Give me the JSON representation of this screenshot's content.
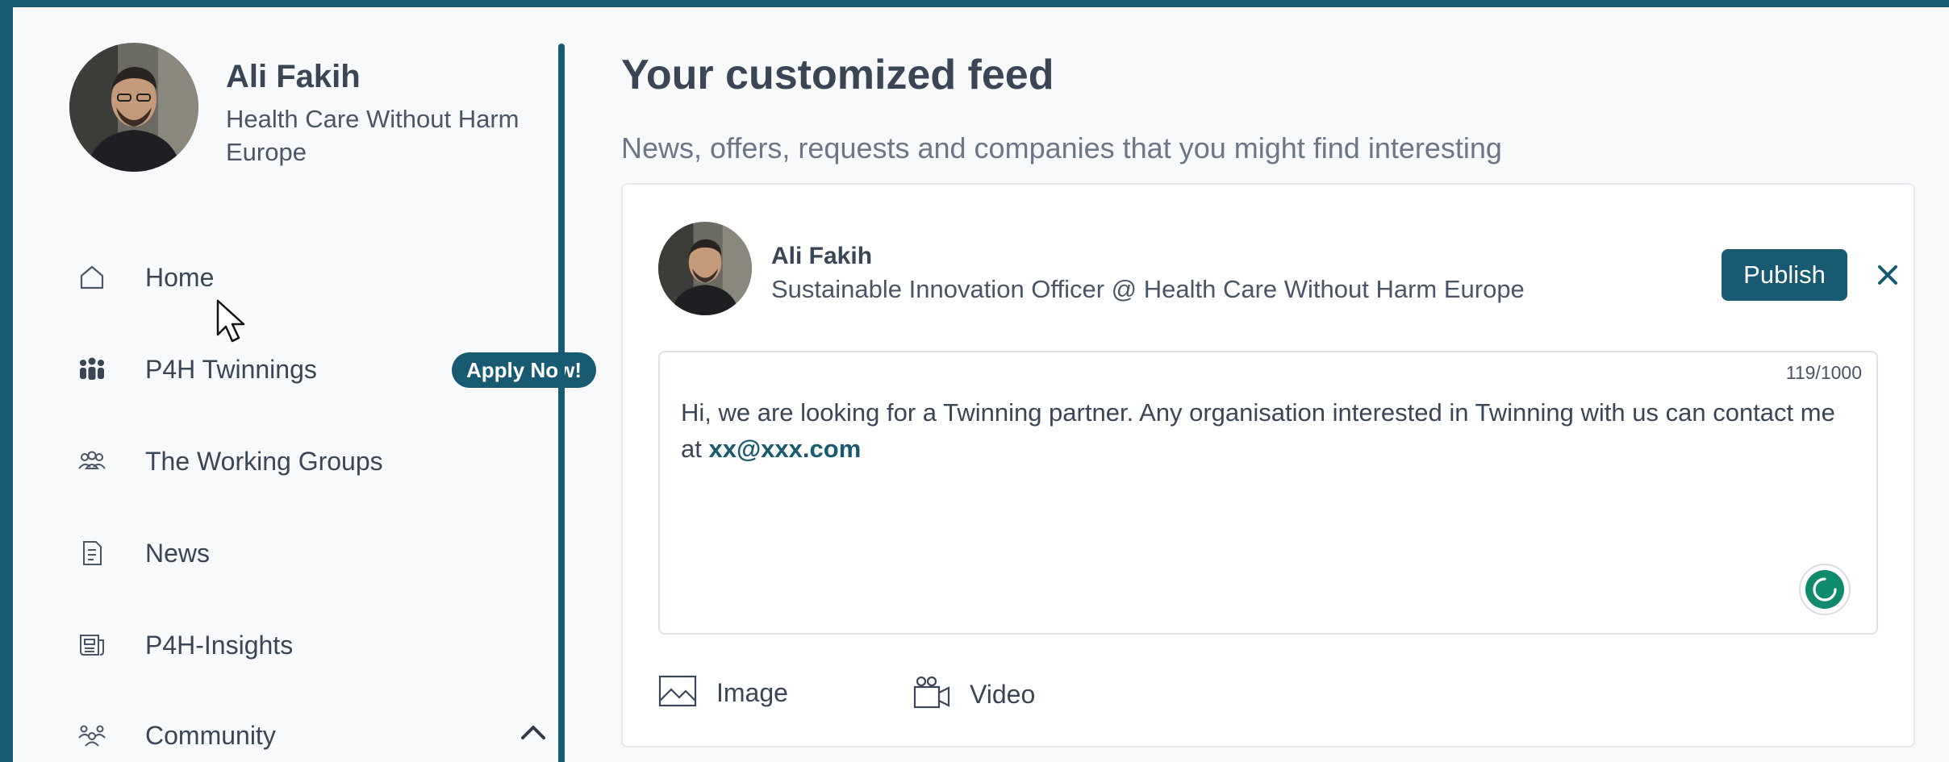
{
  "sidebar": {
    "profile": {
      "name": "Ali Fakih",
      "organization": "Health Care Without Harm Europe"
    },
    "nav": [
      {
        "label": "Home",
        "icon": "home-icon"
      },
      {
        "label": "P4H Twinnings",
        "icon": "people-group-icon",
        "badge": "Apply Now!"
      },
      {
        "label": "The Working Groups",
        "icon": "users-icon"
      },
      {
        "label": "News",
        "icon": "document-icon"
      },
      {
        "label": "P4H-Insights",
        "icon": "newspaper-icon"
      },
      {
        "label": "Community",
        "icon": "community-icon"
      }
    ]
  },
  "main": {
    "title": "Your customized feed",
    "subtitle": "News, offers, requests and companies that you might find interesting",
    "composer": {
      "author_name": "Ali Fakih",
      "author_role": "Sustainable Innovation Officer @ Health Care Without Harm Europe",
      "publish_label": "Publish",
      "char_count": "119/1000",
      "text_prefix": "Hi, we are looking for a Twinning partner. Any organisation interested in Twinning with us can contact me at ",
      "text_link": "xx@xxx.com",
      "image_label": "Image",
      "video_label": "Video"
    }
  },
  "colors": {
    "brand": "#175a72",
    "background": "#f7f9fb",
    "text": "#3a4656"
  }
}
